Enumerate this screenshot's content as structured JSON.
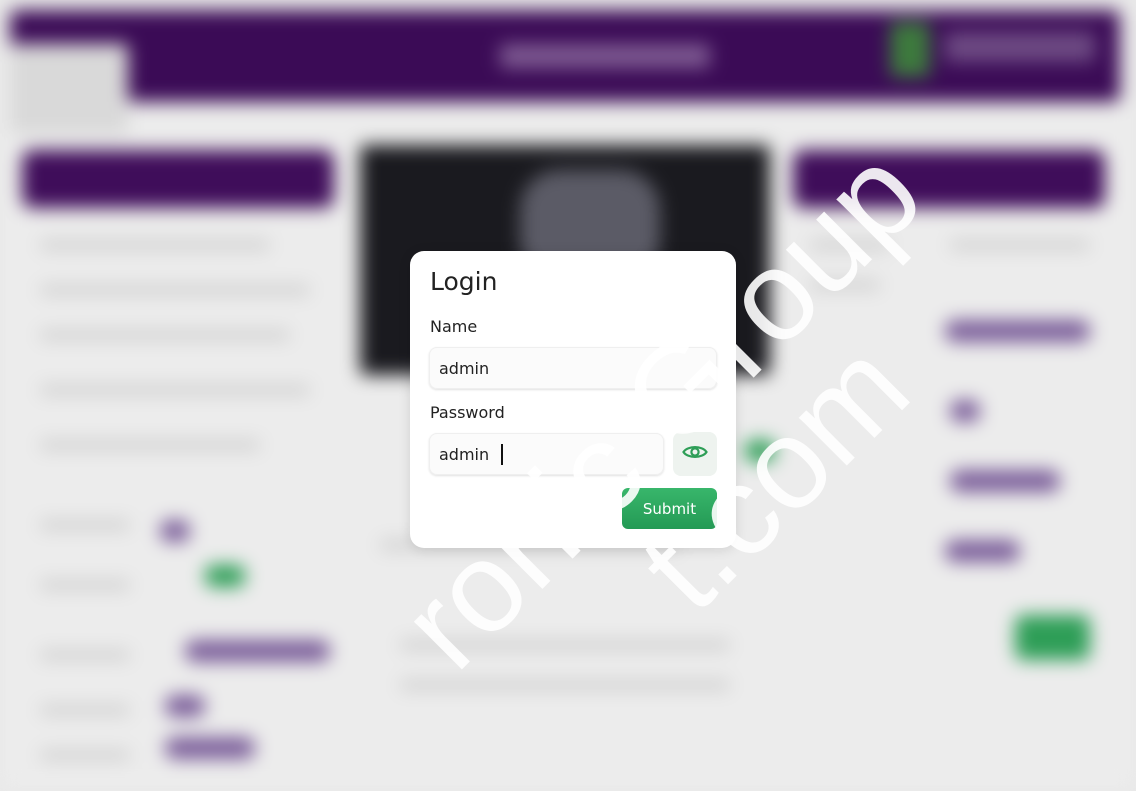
{
  "login": {
    "title": "Login",
    "name_label": "Name",
    "name_value": "admin",
    "password_label": "Password",
    "password_value": "admin",
    "submit_label": "Submit"
  },
  "watermark": {
    "line1": "ronic Group",
    "line2": "t.com"
  },
  "colors": {
    "header_purple": "#3b0b56",
    "accent_green": "#2e9e57",
    "eye_icon": "#2e9e57"
  },
  "icons": {
    "password_toggle": "eye-icon"
  }
}
